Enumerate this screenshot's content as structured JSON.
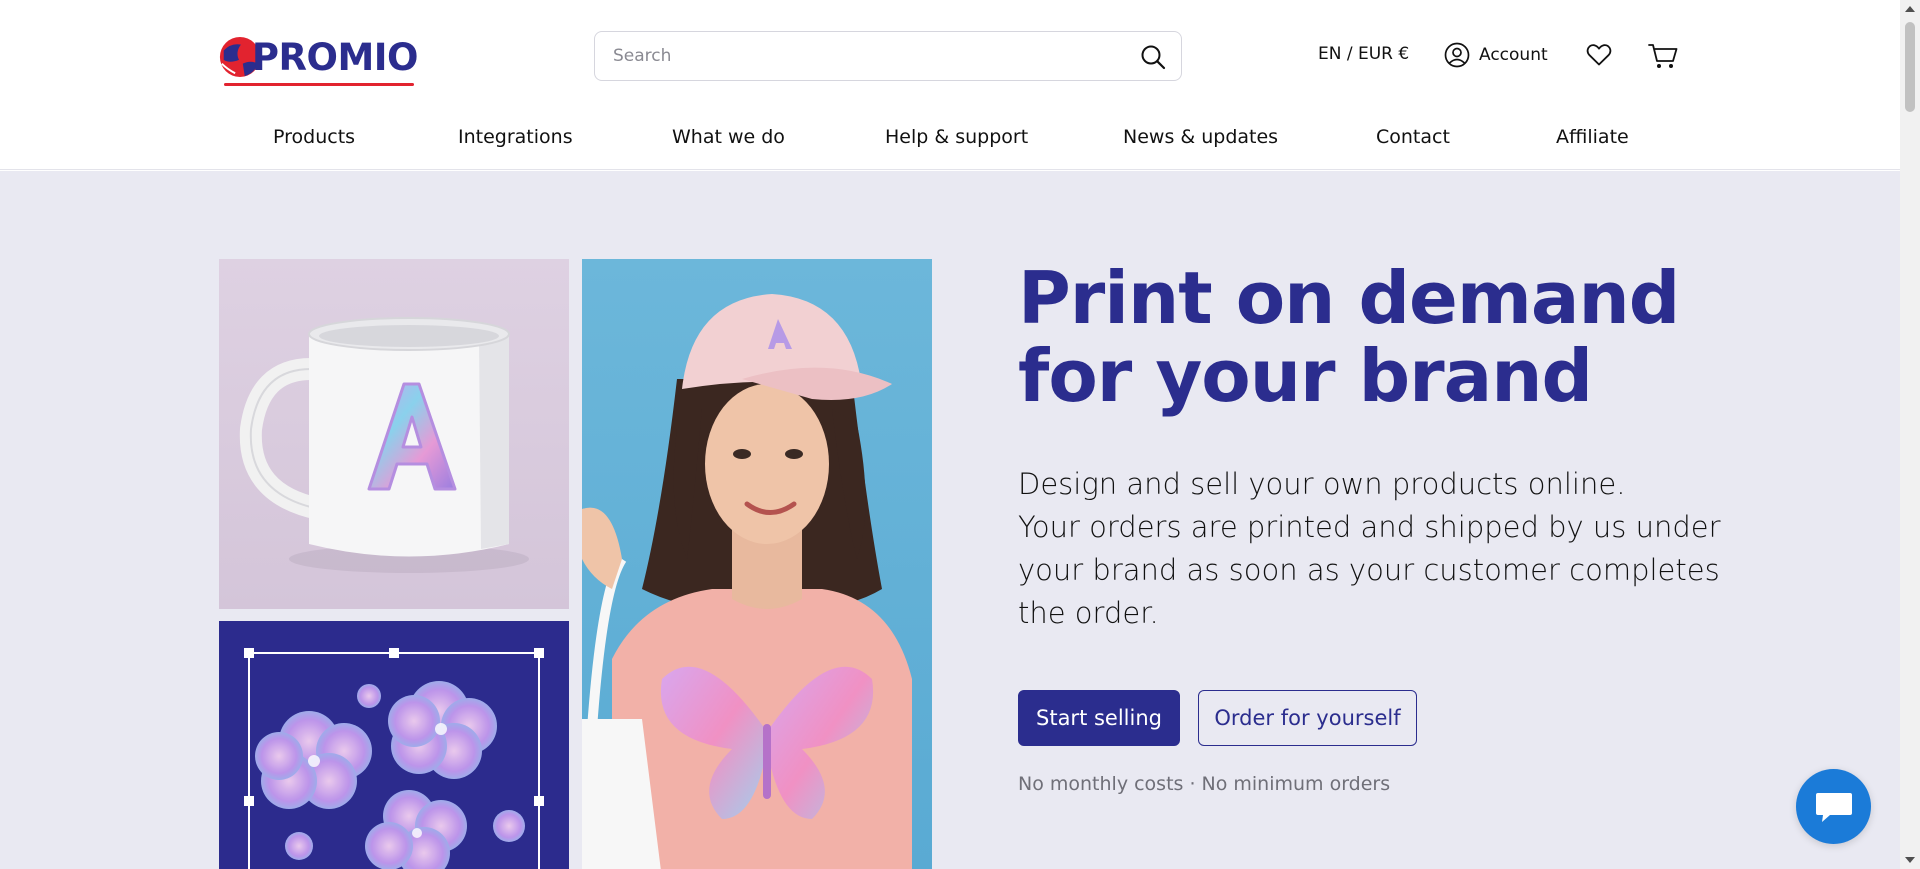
{
  "brand": {
    "logo_text": "PROMIO",
    "accent": "#2b2d8e",
    "logo_red": "#e2232f"
  },
  "search": {
    "placeholder": "Search"
  },
  "header": {
    "language_currency": "EN / EUR €",
    "account_label": "Account"
  },
  "nav": {
    "items": [
      {
        "label": "Products"
      },
      {
        "label": "Integrations"
      },
      {
        "label": "What we do"
      },
      {
        "label": "Help & support"
      },
      {
        "label": "News & updates"
      },
      {
        "label": "Contact"
      },
      {
        "label": "Affiliate"
      }
    ]
  },
  "hero": {
    "title_line1": "Print on demand",
    "title_line2": "for your brand",
    "subtitle_line1": "Design and sell your own products online.",
    "subtitle_line2": "Your orders are printed and shipped by us under",
    "subtitle_line3": "your brand as soon as your customer completes",
    "subtitle_line4": "the order.",
    "primary_button": "Start selling",
    "secondary_button": "Order for yourself",
    "feature_1": "No monthly costs",
    "feature_separator": "·",
    "feature_2": "No minimum orders",
    "background": "#e9e9f2"
  },
  "chat": {
    "color": "#1b7bd8"
  }
}
